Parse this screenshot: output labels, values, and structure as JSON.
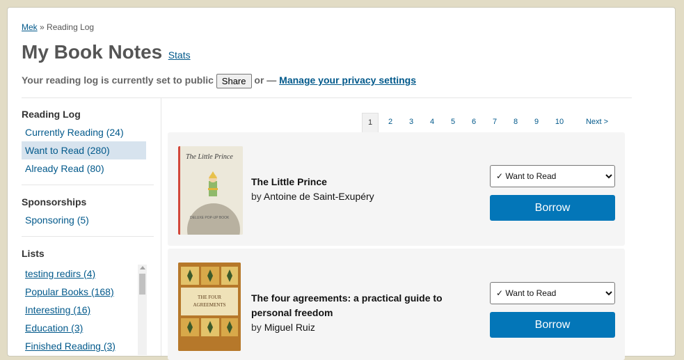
{
  "breadcrumb": {
    "home": "Mek",
    "separator": "»",
    "current": "Reading Log"
  },
  "header": {
    "title": "My Book Notes",
    "stats_link": "Stats"
  },
  "privacy": {
    "prefix": "Your reading log is currently set to public",
    "share_label": "Share",
    "middle": "or —",
    "manage_link": "Manage your privacy settings"
  },
  "sidebar": {
    "reading_log": {
      "heading": "Reading Log",
      "items": [
        {
          "label": "Currently Reading (24)",
          "selected": false
        },
        {
          "label": "Want to Read (280)",
          "selected": true
        },
        {
          "label": "Already Read (80)",
          "selected": false
        }
      ]
    },
    "sponsorships": {
      "heading": "Sponsorships",
      "items": [
        {
          "label": "Sponsoring (5)"
        }
      ]
    },
    "lists": {
      "heading": "Lists",
      "items": [
        {
          "label": "testing redirs (4)"
        },
        {
          "label": "Popular Books (168)"
        },
        {
          "label": "Interesting (16)"
        },
        {
          "label": "Education (3)"
        },
        {
          "label": "Finished Reading (3)"
        }
      ]
    }
  },
  "pagination": {
    "pages": [
      "1",
      "2",
      "3",
      "4",
      "5",
      "6",
      "7",
      "8",
      "9",
      "10"
    ],
    "current": "1",
    "next_label": "Next >"
  },
  "books": [
    {
      "title": "The Little Prince",
      "by": "by",
      "author": "Antoine de Saint-Exupéry",
      "shelf": "✓ Want to Read",
      "borrow_label": "Borrow",
      "cover_title": "The Little Prince",
      "cover_note": "DELUXE POP-UP BOOK"
    },
    {
      "title": "The four agreements: a practical guide to personal freedom",
      "by": "by",
      "author": "Miguel Ruiz",
      "shelf": "✓ Want to Read",
      "borrow_label": "Borrow",
      "cover_title": "THE FOUR AGREEMENTS"
    }
  ],
  "colors": {
    "link": "#02598b",
    "accent": "#0376b8",
    "selected_bg": "#d7e3ee",
    "backdrop": "#e2dcc5"
  }
}
